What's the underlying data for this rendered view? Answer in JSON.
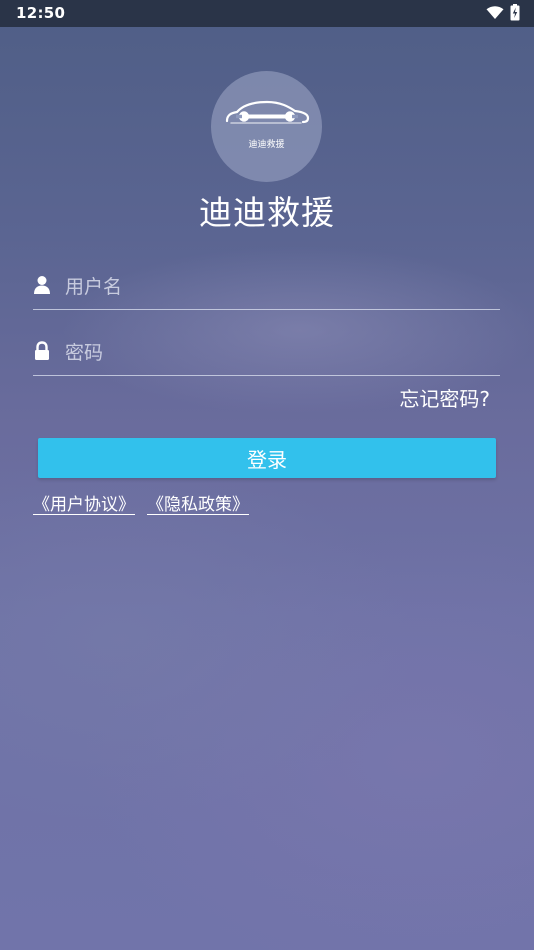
{
  "status_bar": {
    "time": "12:50"
  },
  "logo": {
    "caption": "迪迪救援"
  },
  "app": {
    "title": "迪迪救援"
  },
  "login_form": {
    "username_placeholder": "用户名",
    "username_value": "",
    "password_placeholder": "密码",
    "password_value": "",
    "forgot_password_label": "忘记密码?",
    "login_button_label": "登录"
  },
  "agreements": {
    "user_agreement_label": "《用户协议》",
    "privacy_policy_label": "《隐私政策》"
  },
  "colors": {
    "accent": "#32c1ec",
    "status_bar": "#2a3448",
    "text": "#ffffff"
  },
  "icons": {
    "status": [
      "wifi-icon",
      "battery-charging-icon"
    ],
    "logo": "car-wrench-icon",
    "username": "person-icon",
    "password": "lock-icon"
  }
}
